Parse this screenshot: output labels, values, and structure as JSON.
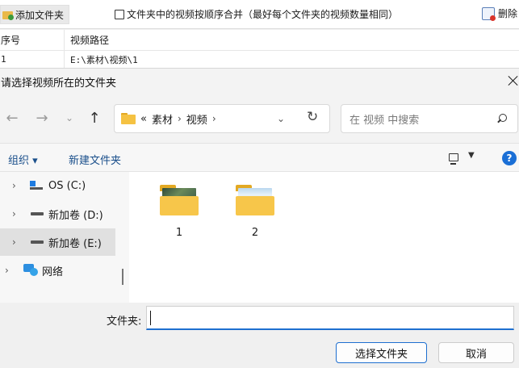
{
  "app": {
    "toolbar": {
      "add_folder_label": "添加文件夹",
      "merge_checkbox_label": "文件夹中的视频按顺序合并（最好每个文件夹的视频数量相同）",
      "merge_checked": false,
      "delete_label": "删除"
    },
    "table": {
      "headers": [
        "序号",
        "视频路径"
      ],
      "rows": [
        {
          "index": "1",
          "path": "E:\\素材\\视频\\1"
        }
      ]
    }
  },
  "dialog": {
    "title": "请选择视频所在的文件夹",
    "breadcrumb": {
      "overflow": "«",
      "segments": [
        "素材",
        "视频"
      ],
      "separator": "›"
    },
    "search_placeholder": "在 视频 中搜索",
    "commands": {
      "organize": "组织 ▾",
      "new_folder": "新建文件夹"
    },
    "nav_tree": [
      {
        "label": "OS (C:)",
        "icon": "os-drive-icon",
        "selected": false
      },
      {
        "label": "新加卷 (D:)",
        "icon": "drive-icon",
        "selected": false
      },
      {
        "label": "新加卷 (E:)",
        "icon": "drive-icon",
        "selected": true
      },
      {
        "label": "网络",
        "icon": "network-icon",
        "selected": false
      }
    ],
    "folders": [
      {
        "name": "1"
      },
      {
        "name": "2"
      }
    ],
    "folder_field_label": "文件夹:",
    "folder_field_value": "",
    "buttons": {
      "select": "选择文件夹",
      "cancel": "取消"
    },
    "colors": {
      "accent": "#1e6fd0",
      "link": "#1a4f8b",
      "folder": "#f7c64a"
    }
  }
}
